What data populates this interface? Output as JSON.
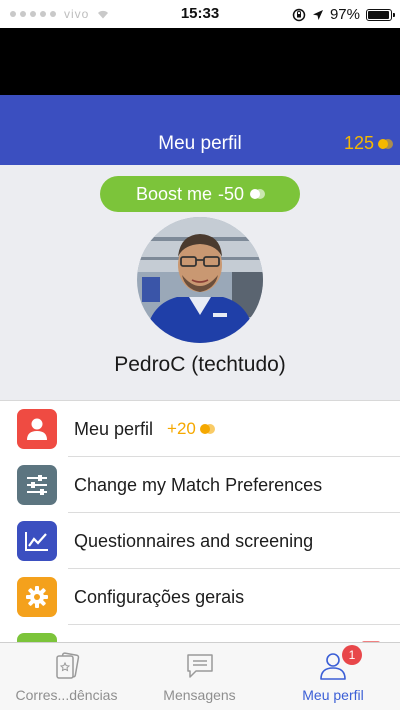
{
  "status_bar": {
    "carrier": "vivo",
    "time": "15:33",
    "battery_percent": "97%",
    "battery_level": 0.97
  },
  "header": {
    "title": "Meu perfil",
    "coins": "125",
    "accent_color": "#3b4fc0",
    "coin_color": "#f5b800"
  },
  "profile": {
    "boost_label": "Boost me",
    "boost_cost": "-50",
    "username": "PedroC (techtudo)",
    "boost_color": "#7cc43a"
  },
  "menu": {
    "items": [
      {
        "label": "Meu perfil",
        "reward": "+20",
        "icon": "person-icon",
        "color": "#ef4b42"
      },
      {
        "label": "Change my Match Preferences",
        "icon": "sliders-icon",
        "color": "#5c7580"
      },
      {
        "label": "Questionnaires and screening",
        "icon": "chart-icon",
        "color": "#3b4fc0"
      },
      {
        "label": "Configurações gerais",
        "icon": "gear-icon",
        "color": "#f4a11c"
      }
    ]
  },
  "tabbar": {
    "tabs": [
      {
        "label": "Corres...dências",
        "icon": "cards-icon"
      },
      {
        "label": "Mensagens",
        "icon": "chat-icon"
      },
      {
        "label": "Meu perfil",
        "icon": "user-icon",
        "badge": "1",
        "active": true
      }
    ],
    "active_color": "#3b5fd6"
  }
}
